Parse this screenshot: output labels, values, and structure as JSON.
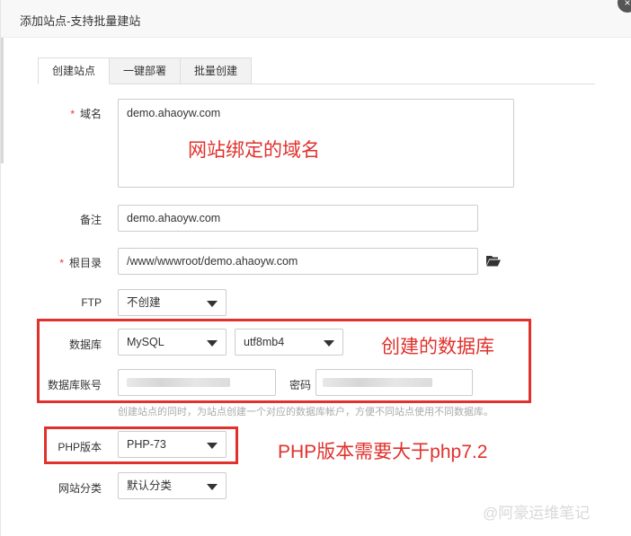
{
  "dialog": {
    "title": "添加站点-支持批量建站",
    "close_glyph": "×"
  },
  "tabs": [
    {
      "label": "创建站点",
      "active": true
    },
    {
      "label": "一键部署",
      "active": false
    },
    {
      "label": "批量创建",
      "active": false
    }
  ],
  "form": {
    "required_mark": "*",
    "domain": {
      "label": "域名",
      "value": "demo.ahaoyw.com"
    },
    "remark": {
      "label": "备注",
      "value": "demo.ahaoyw.com"
    },
    "root": {
      "label": "根目录",
      "value": "/www/wwwroot/demo.ahaoyw.com"
    },
    "ftp": {
      "label": "FTP",
      "value": "不创建"
    },
    "database": {
      "label": "数据库",
      "type_value": "MySQL",
      "charset_value": "utf8mb4"
    },
    "db_account": {
      "label": "数据库账号",
      "value": ""
    },
    "db_password": {
      "label": "密码",
      "value": ""
    },
    "hint": "创建站点的同时，为站点创建一个对应的数据库帐户，方便不同站点使用不同数据库。",
    "php": {
      "label": "PHP版本",
      "value": "PHP-73"
    },
    "category": {
      "label": "网站分类",
      "value": "默认分类"
    }
  },
  "annotations": {
    "domain_note": "网站绑定的域名",
    "database_note": "创建的数据库",
    "php_note": "PHP版本需要大于php7.2",
    "color": "#e0312c"
  },
  "watermark": "@阿豪运维笔记",
  "icons": {
    "folder": "folder-open-icon",
    "dropdown": "caret-down-icon"
  }
}
